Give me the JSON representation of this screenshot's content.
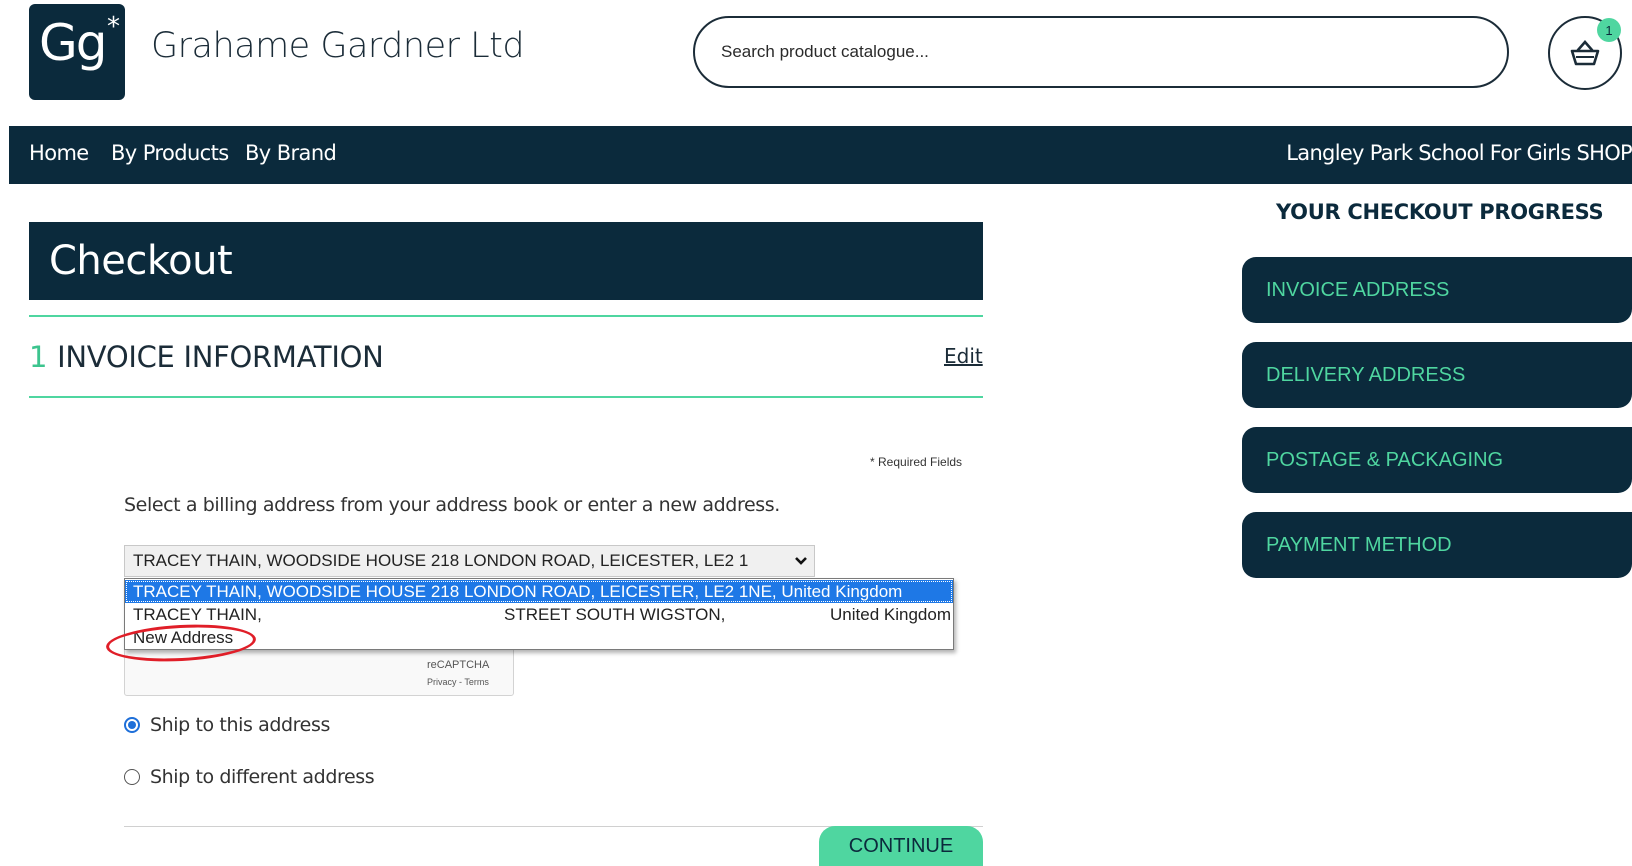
{
  "brand": {
    "logo_letters": "Gg",
    "logo_star": "*",
    "company_name": "Grahame Gardner Ltd"
  },
  "search": {
    "placeholder": "Search product catalogue..."
  },
  "basket": {
    "icon": "basket-icon",
    "count": "1"
  },
  "nav": {
    "items": [
      {
        "label": "Home"
      },
      {
        "label": "By Products"
      },
      {
        "label": "By Brand"
      }
    ],
    "shop_name": "Langley Park School For Girls SHOP"
  },
  "page": {
    "title": "Checkout"
  },
  "section": {
    "number": "1",
    "title": "INVOICE INFORMATION",
    "edit_label": "Edit",
    "required_note": "* Required Fields"
  },
  "billing": {
    "instruction": "Select a billing address from your address book or enter a new address.",
    "selected_value": "TRACEY THAIN, WOODSIDE HOUSE 218 LONDON ROAD, LEICESTER, LE2 1",
    "options": [
      {
        "label": "TRACEY THAIN, WOODSIDE HOUSE 218 LONDON ROAD, LEICESTER, LE2 1NE, United Kingdom"
      },
      {
        "label_start": "TRACEY THAIN,",
        "label_end": "STREET SOUTH WIGSTON,",
        "label_country": "United Kingdom"
      },
      {
        "label": "New Address"
      }
    ]
  },
  "recaptcha": {
    "fragment": "...",
    "label": "reCAPTCHA",
    "links": "Privacy - Terms"
  },
  "shipping": {
    "option_same": "Ship to this address",
    "option_different": "Ship to different address",
    "selected": "same"
  },
  "actions": {
    "continue_label": "CONTINUE"
  },
  "progress": {
    "title": "YOUR CHECKOUT PROGRESS",
    "steps": [
      {
        "label": "INVOICE ADDRESS"
      },
      {
        "label": "DELIVERY ADDRESS"
      },
      {
        "label": "POSTAGE & PACKAGING"
      },
      {
        "label": "PAYMENT METHOD"
      }
    ]
  },
  "colors": {
    "navy": "#0b2a3c",
    "accent_green": "#4fd6a0",
    "selection_blue": "#1e78e6",
    "annotation_red": "#e01e28"
  }
}
